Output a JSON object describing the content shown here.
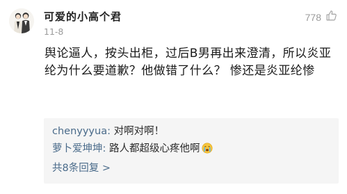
{
  "post": {
    "username": "可爱的小高个君",
    "date": "11-8",
    "like_count": "778",
    "text": "舆论逼人，按头出柜，过后B男再出来澄清，所以炎亚纶为什么要道歉？他做错了什么？ 惨还是炎亚纶惨"
  },
  "replies": {
    "items": [
      {
        "user": "chenyyyua",
        "sep": ":",
        "text": " 对啊对啊！"
      },
      {
        "user": "萝卜爱坤坤",
        "sep": ":",
        "text": " 路人都超级心疼他啊"
      }
    ],
    "more_label": "共8条回复 >"
  },
  "colors": {
    "link": "#4a6b8a",
    "reply_bg": "#f5f5f5",
    "muted": "#9a9a9a"
  },
  "icons": {
    "like": "thumbs-up-icon",
    "avatar": "avatar-couple-illustration",
    "emoji": "crying-face-emoji"
  }
}
